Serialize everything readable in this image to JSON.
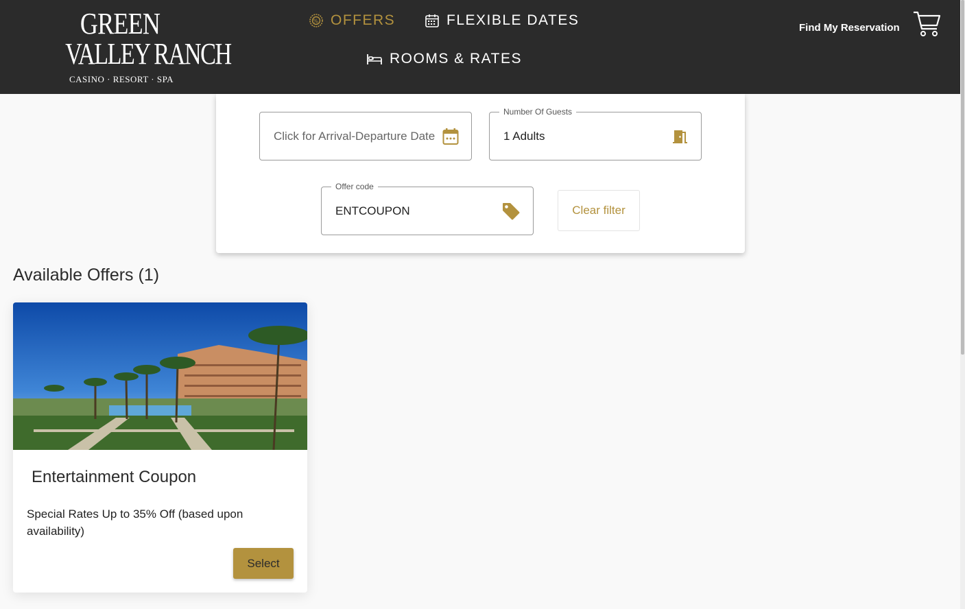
{
  "brand": {
    "line1": "GREEN",
    "line2": "VALLEY RANCH",
    "tagline": "CASINO · RESORT · SPA"
  },
  "nav": {
    "offers": "OFFERS",
    "flexible_dates": "FLEXIBLE DATES",
    "rooms_rates": "ROOMS & RATES"
  },
  "header": {
    "find_reservation": "Find My Reservation"
  },
  "search": {
    "date_placeholder": "Click for Arrival-Departure Date",
    "guests_label": "Number Of Guests",
    "guests_value": "1 Adults",
    "offer_label": "Offer code",
    "offer_value": "ENTCOUPON",
    "clear_label": "Clear filter"
  },
  "offers": {
    "heading": "Available Offers (1)",
    "items": [
      {
        "title": "Entertainment Coupon",
        "description": "Special Rates Up to 35% Off (based upon availability)",
        "select_label": "Select"
      }
    ]
  },
  "colors": {
    "accent": "#b3923e",
    "header_bg": "#2b2b2b",
    "page_bg": "#f9f9f9"
  },
  "icons": {
    "offers": "offers-badge-icon",
    "flexible_dates": "calendar-grid-icon",
    "rooms": "bed-icon",
    "cart": "shopping-cart-icon",
    "date": "calendar-icon",
    "guests": "door-icon",
    "offer": "tag-icon"
  }
}
